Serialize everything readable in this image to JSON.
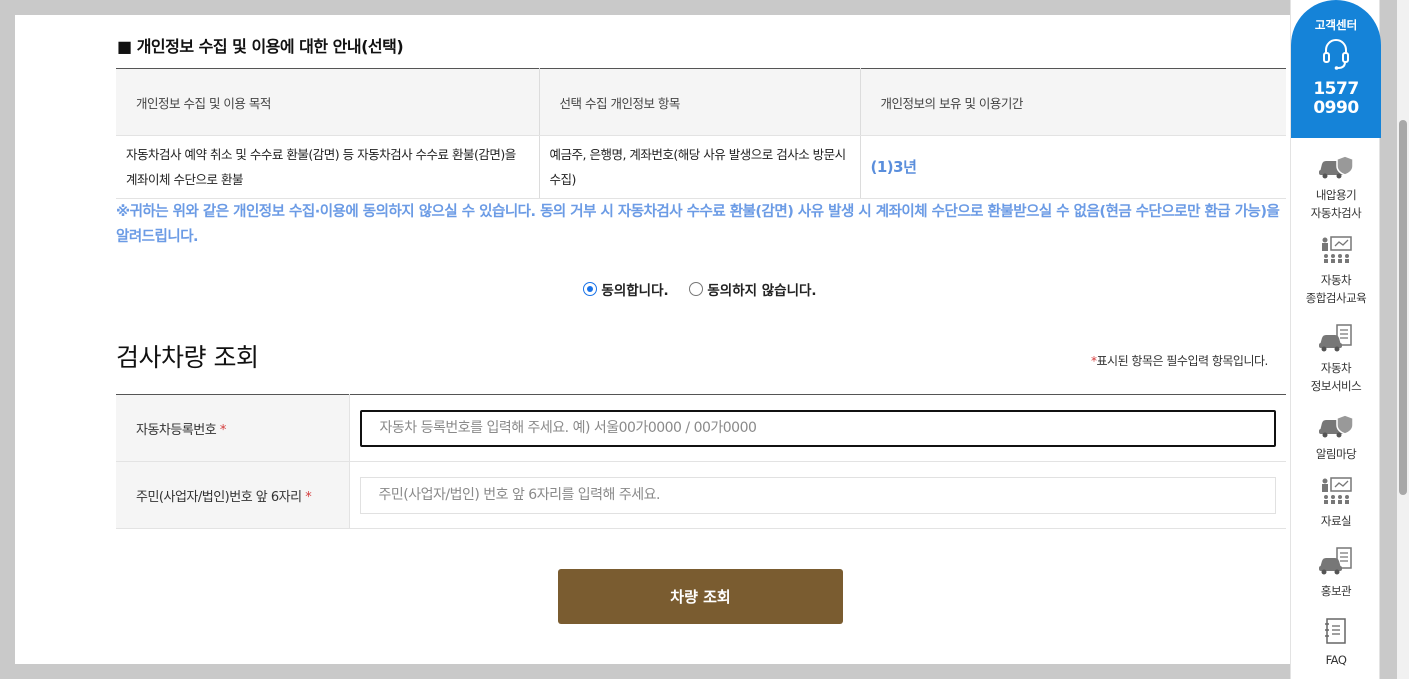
{
  "privacy": {
    "title": "■ 개인정보 수집 및 이용에 대한 안내(선택)",
    "headers": [
      "개인정보 수집 및 이용 목적",
      "선택 수집 개인정보 항목",
      "개인정보의 보유 및 이용기간"
    ],
    "row": {
      "purpose": "자동차검사 예약 취소 및 수수료 환불(감면) 등 자동차검사 수수료 환불(감면)을 계좌이체 수단으로 환불",
      "items": "예금주, 은행명, 계좌번호(해당 사유 발생으로 검사소 방문시 수집)",
      "period": "(1)3년"
    },
    "notice": "※귀하는 위와 같은 개인정보 수집·이용에 동의하지 않으실 수 있습니다. 동의 거부 시 자동차검사 수수료 환불(감면) 사유 발생 시 계좌이체 수단으로 환불받으실 수 없음(현금 수단으로만 환급 가능)을 알려드립니다.",
    "agree_label": "동의합니다.",
    "disagree_label": "동의하지 않습니다.",
    "selected": "agree"
  },
  "lookup": {
    "title": "검사차량 조회",
    "required_star": "*",
    "required_note": "표시된 항목은 필수입력 항목입니다.",
    "fields": [
      {
        "label": "자동차등록번호",
        "star": "*",
        "placeholder": "자동차 등록번호를 입력해 주세요. 예) 서울00가0000 / 00가0000"
      },
      {
        "label": "주민(사업자/법인)번호 앞 6자리",
        "star": "*",
        "placeholder": "주민(사업자/법인) 번호 앞 6자리를 입력해 주세요."
      }
    ],
    "button_label": "차량 조회"
  },
  "quick_menu": {
    "cs_label": "고객센터",
    "cs_number_1": "1577",
    "cs_number_2": "0990",
    "items": [
      {
        "line1": "내압용기",
        "line2": "자동차검사",
        "icon": "car-shield-icon"
      },
      {
        "line1": "자동차",
        "line2": "종합검사교육",
        "icon": "presentation-icon"
      },
      {
        "line1": "자동차",
        "line2": "정보서비스",
        "icon": "car-checklist-icon"
      },
      {
        "line1": "알림마당",
        "line2": "",
        "icon": "car-shield-icon"
      },
      {
        "line1": "자료실",
        "line2": "",
        "icon": "presentation-icon"
      },
      {
        "line1": "홍보관",
        "line2": "",
        "icon": "car-checklist-icon"
      },
      {
        "line1": "FAQ",
        "line2": "",
        "icon": "notebook-icon"
      }
    ],
    "accent_color": "#1583d8"
  },
  "colors": {
    "notice": "#6b9be5",
    "button": "#7a5c30",
    "required": "#d43b3b"
  }
}
